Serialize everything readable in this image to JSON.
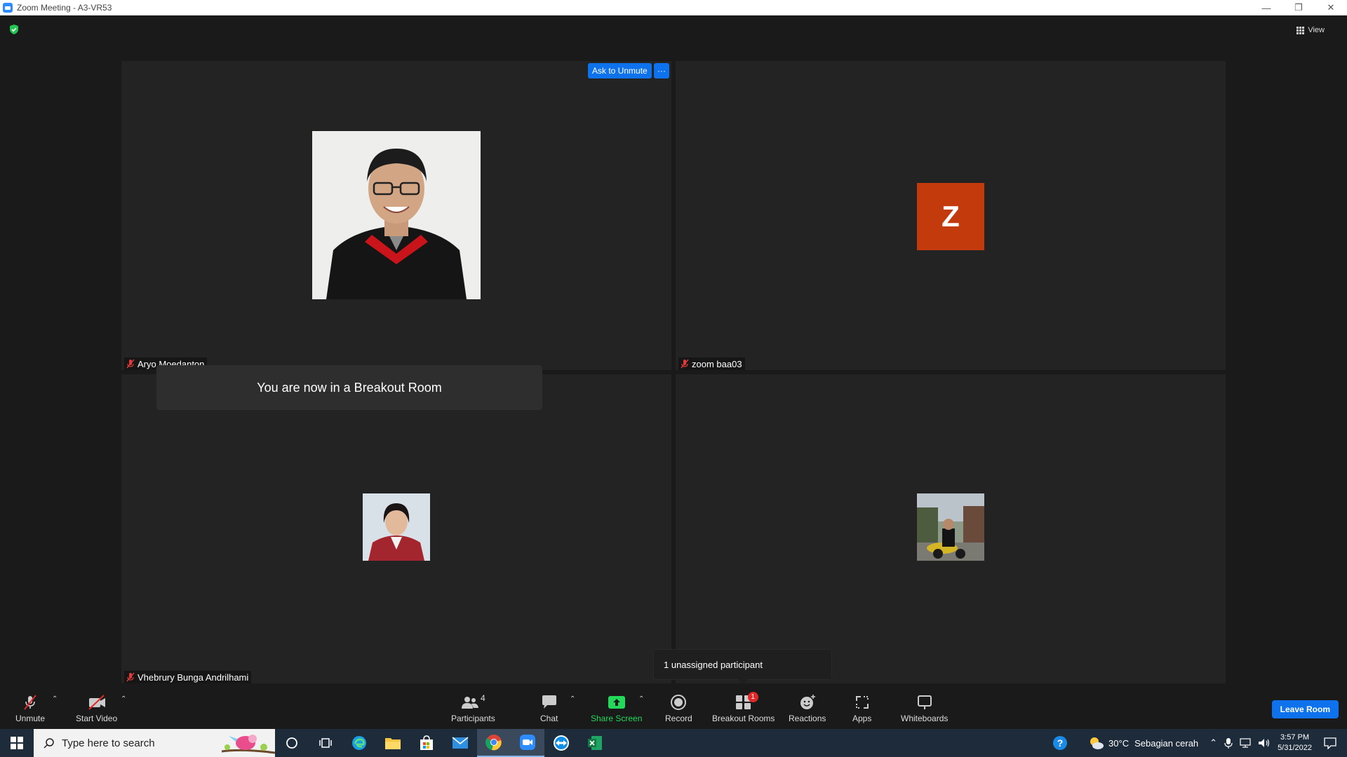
{
  "window": {
    "title": "Zoom Meeting - A3-VR53",
    "minimize": "—",
    "restore": "❐",
    "close": "✕"
  },
  "view_button": {
    "label": "View"
  },
  "tiles": [
    {
      "name": "Aryo Moedanton",
      "has_photo": true
    },
    {
      "name": "zoom baa03",
      "avatar_letter": "Z",
      "avatar_color": "#c33a0c"
    },
    {
      "name": "Vhebrury Bunga Andrilhami",
      "has_photo": true
    },
    {
      "name": "",
      "has_photo": true
    }
  ],
  "ask_to_unmute": {
    "label": "Ask to Unmute",
    "more": "···"
  },
  "toast": {
    "message": "You are now in a Breakout Room"
  },
  "unassigned_popup": {
    "message": "1 unassigned participant"
  },
  "toolbar": {
    "unmute": "Unmute",
    "start_video": "Start Video",
    "participants": "Participants",
    "participants_count": "4",
    "chat": "Chat",
    "share_screen": "Share Screen",
    "record": "Record",
    "breakout_rooms": "Breakout Rooms",
    "breakout_badge": "1",
    "reactions": "Reactions",
    "apps": "Apps",
    "whiteboards": "Whiteboards",
    "leave": "Leave Room",
    "share_color": "#23d959",
    "leave_color": "#0e72ed"
  },
  "taskbar": {
    "search_placeholder": "Type here to search",
    "weather_temp": "30°C",
    "weather_desc": "Sebagian cerah",
    "time": "3:57 PM",
    "date": "5/31/2022"
  }
}
